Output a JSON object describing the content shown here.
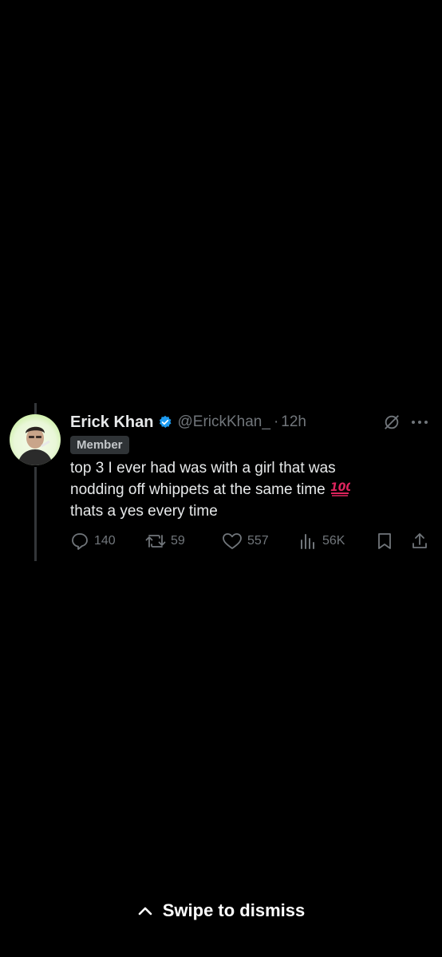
{
  "tweet": {
    "display_name": "Erick Khan",
    "handle": "@ErickKhan_",
    "separator": "·",
    "time": "12h",
    "badge": "Member",
    "text_line1": "top 3 I ever had was with a girl that was",
    "text_line2": "nodding off whippets at the same time",
    "text_emoji": "100-emoji",
    "text_line3": "thats a yes every time"
  },
  "actions": {
    "replies": "140",
    "reposts": "59",
    "likes": "557",
    "views": "56K"
  },
  "icons": {
    "reply": "reply-icon",
    "repost": "repost-icon",
    "like": "heart-icon",
    "views": "views-icon",
    "bookmark": "bookmark-icon",
    "share": "share-icon",
    "grok": "grok-icon",
    "more": "more-icon",
    "verified": "verified-icon",
    "dismiss": "chevron-up-icon"
  },
  "dismiss": {
    "label": "Swipe to dismiss"
  },
  "colors": {
    "background": "#000000",
    "text": "#e7e9ea",
    "muted": "#71767b",
    "verified": "#1d9bf0",
    "badge_bg": "#2f3336",
    "emoji_red": "#e0245e"
  }
}
